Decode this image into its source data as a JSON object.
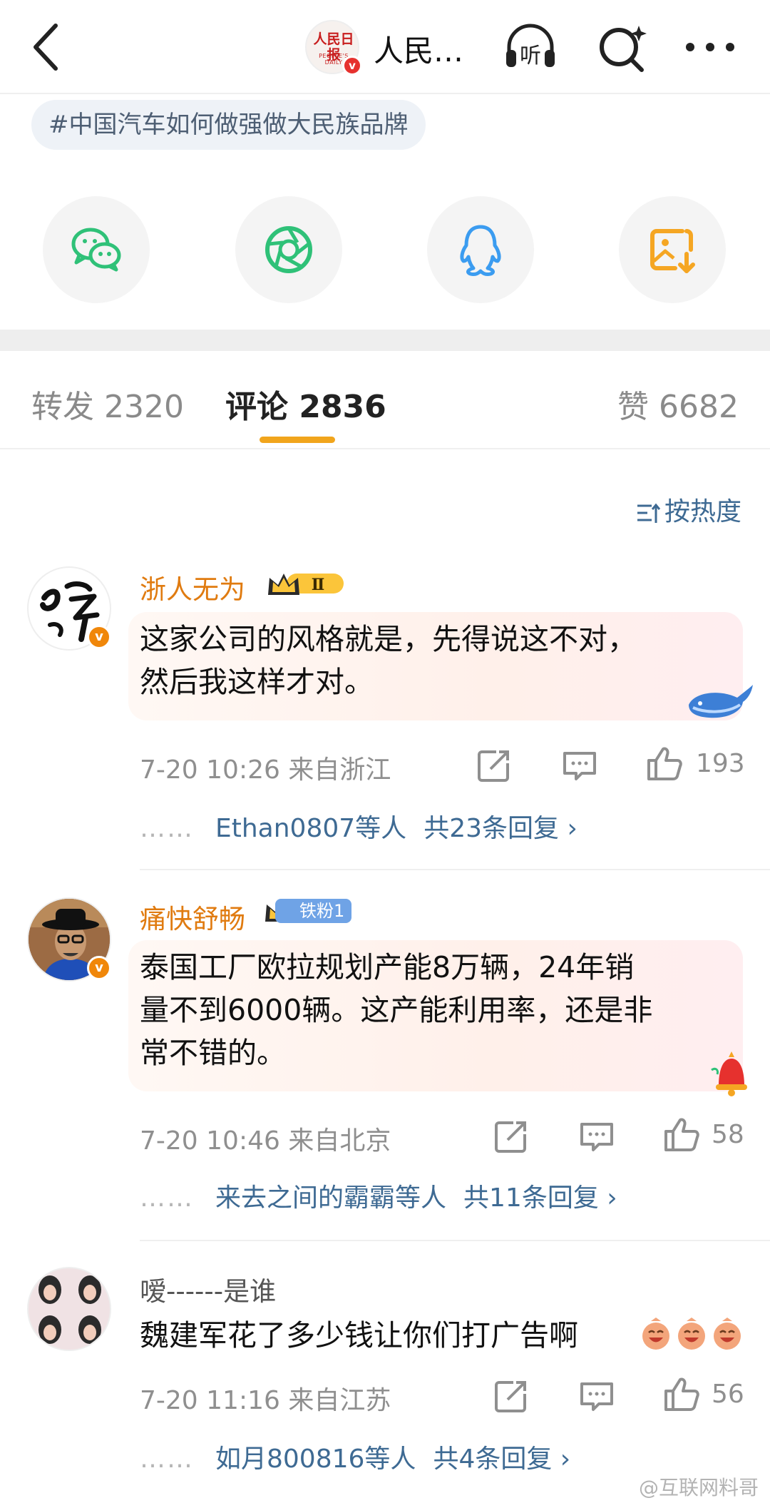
{
  "header": {
    "account_name": "人民…",
    "account_logo_text": "人民日报",
    "account_logo_sub": "PEOPLE'S DAILY",
    "listen_label": "听"
  },
  "topic": "#中国汽车如何做强做大民族品牌",
  "share": {
    "icons": [
      "wechat-icon",
      "moments-icon",
      "qq-icon",
      "save-image-icon"
    ],
    "colors": {
      "wechat": "#2fc178",
      "moments": "#2fc178",
      "qq": "#3b9cf0",
      "save": "#f5a623"
    }
  },
  "tabs": [
    {
      "label": "转发",
      "count": "2320"
    },
    {
      "label": "评论",
      "count": "2836"
    },
    {
      "label": "赞",
      "count": "6682"
    }
  ],
  "sort_label": "按热度",
  "comments": [
    {
      "user": "浙人无为",
      "level_badge": "Ⅱ",
      "text_lines": [
        "这家公司的风格就是，先得说这不对，",
        "然后我这样才对。"
      ],
      "time": "7-20 10:26",
      "location": "来自浙江",
      "likes": "193",
      "reply_users": "Ethan0807等人",
      "reply_total": "共23条回复 ›"
    },
    {
      "user": "痛快舒畅",
      "fan_badge": "铁粉1",
      "text_lines": [
        "泰国工厂欧拉规划产能8万辆，24年销",
        "量不到6000辆。这产能利用率，还是非",
        "常不错的。"
      ],
      "time": "7-20 10:46",
      "location": "来自北京",
      "likes": "58",
      "reply_users": "来去之间的霸霸等人",
      "reply_total": "共11条回复 ›"
    },
    {
      "user": "嗳------是谁",
      "text_lines": [
        "魏建军花了多少钱让你们打广告啊"
      ],
      "time": "7-20 11:16",
      "location": "来自江苏",
      "likes": "56",
      "reply_users": "如月800816等人",
      "reply_total": "共4条回复 ›"
    }
  ],
  "reply_dots": "……",
  "watermark": "@互联网料哥"
}
